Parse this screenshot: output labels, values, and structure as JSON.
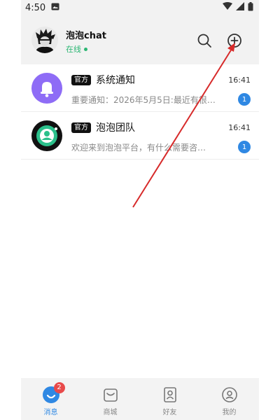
{
  "status_bar": {
    "time": "4:50",
    "left_icon": "image-icon",
    "right_icons": [
      "wifi-icon",
      "signal-icon",
      "battery-icon"
    ]
  },
  "header": {
    "app_name": "泡泡chat",
    "status": "在线",
    "search_icon": "search-icon",
    "add_icon": "plus-circle-icon"
  },
  "messages": [
    {
      "badge": "官方",
      "name": "系统通知",
      "time": "16:41",
      "preview": "重要通知：2026年5月5日:最近有很…",
      "unread": "1",
      "avatar_icon": "bell-icon",
      "avatar_color": "#8e6cf6"
    },
    {
      "badge": "官方",
      "name": "泡泡团队",
      "time": "16:41",
      "preview": "欢迎来到泡泡平台，有什么需要咨…",
      "unread": "1",
      "avatar_icon": "team-avatar-icon",
      "avatar_color": "#111111"
    }
  ],
  "tabbar": {
    "tabs": [
      {
        "label": "消息",
        "icon": "message-icon",
        "badge": "2",
        "active": true
      },
      {
        "label": "商城",
        "icon": "shop-bag-icon",
        "active": false
      },
      {
        "label": "好友",
        "icon": "contacts-icon",
        "active": false
      },
      {
        "label": "我的",
        "icon": "profile-icon",
        "active": false
      }
    ]
  },
  "colors": {
    "accent": "#2f88e3",
    "online": "#2bb673",
    "unread_badge": "#2f88e3",
    "tab_badge": "#e84a4a",
    "annotation_arrow": "#d72a2a"
  }
}
